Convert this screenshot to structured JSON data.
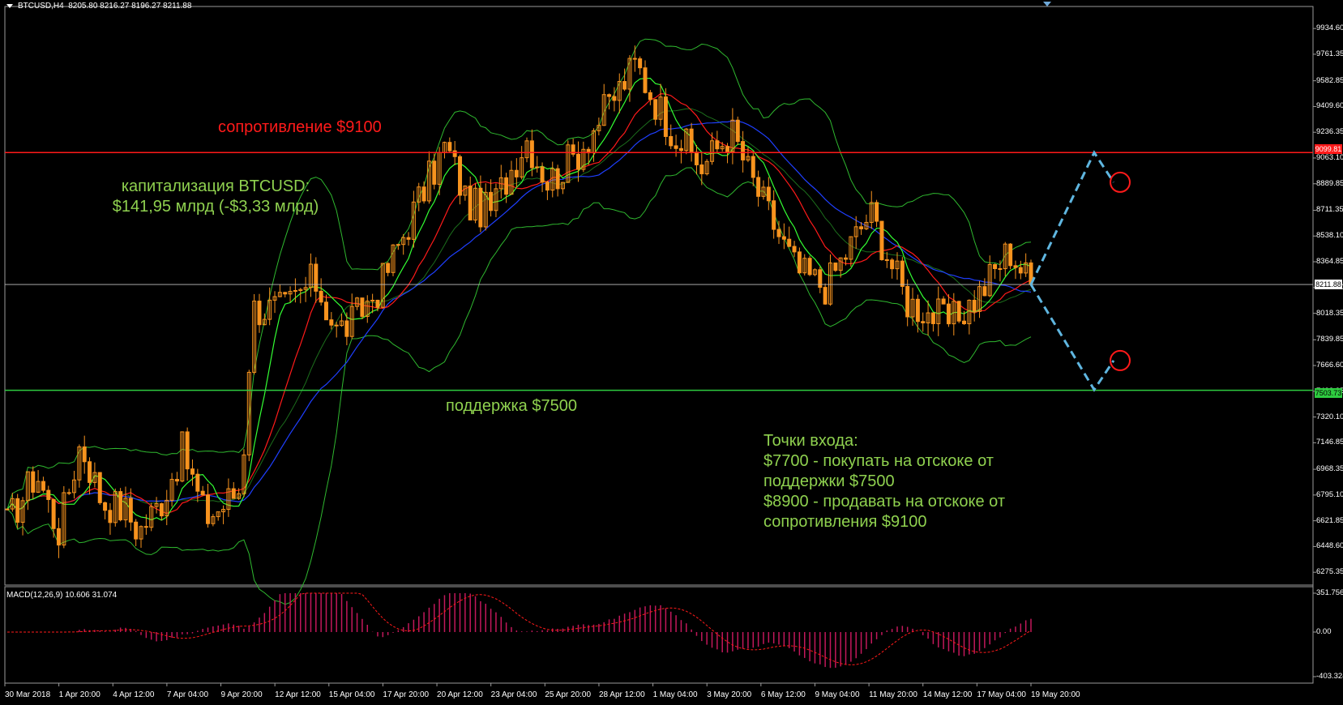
{
  "header": {
    "symbol": "BTCUSD,H4",
    "ohlc": "8205.80 8216.27 8196.27 8211.88"
  },
  "macd_header": "MACD(12,26,9) 10.606 31.074",
  "price_axis": [
    "9934.60",
    "9761.35",
    "9582.85",
    "9409.60",
    "9236.35",
    "9063.10",
    "8889.85",
    "8711.35",
    "8538.10",
    "8364.85",
    "8191.60",
    "8018.35",
    "7839.85",
    "7666.60",
    "7493.35",
    "7320.10",
    "7146.85",
    "6968.35",
    "6795.10",
    "6621.85",
    "6448.60",
    "6275.35"
  ],
  "macd_axis": [
    "351.756",
    "0.00",
    "-403.324"
  ],
  "price_badges": {
    "resistance": "9099.81",
    "support": "7503.73",
    "current": "8211.88"
  },
  "date_axis": [
    "30 Mar 2018",
    "1 Apr 20:00",
    "4 Apr 12:00",
    "7 Apr 04:00",
    "9 Apr 20:00",
    "12 Apr 12:00",
    "15 Apr 04:00",
    "17 Apr 20:00",
    "20 Apr 12:00",
    "23 Apr 04:00",
    "25 Apr 20:00",
    "28 Apr 12:00",
    "1 May 04:00",
    "3 May 20:00",
    "6 May 12:00",
    "9 May 04:00",
    "11 May 20:00",
    "14 May 12:00",
    "17 May 04:00",
    "19 May 20:00"
  ],
  "annotations": {
    "resistance": "сопротивление $9100",
    "cap_line1": "капитализация BTCUSD:",
    "cap_line2": "$141,95 млрд (-$3,33 млрд)",
    "support": "поддержка $7500",
    "entry_title": "Точки входа:",
    "entry_line1": "$7700 - покупать на отскоке от",
    "entry_line2": "поддержки $7500",
    "entry_line3": "$8900 - продавать на отскоке от",
    "entry_line4": "сопротивления $9100"
  },
  "colors": {
    "background": "#000000",
    "candle": "#f7931e",
    "resistance": "#ff1a1a",
    "support": "#2ecc40",
    "bollinger": "#2fb82f",
    "ma_blue": "#1f3fff",
    "ma_red": "#ff1a1a",
    "ma_green": "#33ff33",
    "macd_hist": "#c2185b",
    "macd_signal": "#ff1a1a",
    "projection": "#5fb6e0"
  },
  "levels": {
    "resistance": 9100,
    "support": 7500,
    "current": 8211.88
  },
  "projection": {
    "start_price": 8211.88,
    "peak_price": 9099.81,
    "peak_target": 8900,
    "trough_price": 7503.73,
    "trough_target": 7700
  },
  "price_path": [
    [
      6600,
      0
    ],
    [
      6950,
      0.04
    ],
    [
      6550,
      0.07
    ],
    [
      7150,
      0.1
    ],
    [
      6750,
      0.13
    ],
    [
      6700,
      0.16
    ],
    [
      6550,
      0.18
    ],
    [
      6750,
      0.21
    ],
    [
      7100,
      0.24
    ],
    [
      6650,
      0.27
    ],
    [
      6700,
      0.29
    ],
    [
      6850,
      0.32
    ],
    [
      8050,
      0.335
    ],
    [
      8050,
      0.38
    ],
    [
      8250,
      0.42
    ],
    [
      7900,
      0.45
    ],
    [
      7950,
      0.47
    ],
    [
      8200,
      0.51
    ],
    [
      8750,
      0.56
    ],
    [
      9150,
      0.6
    ],
    [
      8750,
      0.63
    ],
    [
      8700,
      0.66
    ],
    [
      9200,
      0.71
    ],
    [
      8900,
      0.74
    ],
    [
      9100,
      0.78
    ],
    [
      9700,
      0.86
    ],
    [
      9500,
      0.88
    ],
    [
      9250,
      0.91
    ],
    [
      9000,
      0.95
    ],
    [
      9250,
      0.99
    ],
    [
      8900,
      1.02
    ],
    [
      8300,
      1.08
    ],
    [
      8200,
      1.12
    ],
    [
      8700,
      1.18
    ],
    [
      8100,
      1.23
    ],
    [
      7950,
      1.29
    ],
    [
      8150,
      1.33
    ],
    [
      8450,
      1.37
    ],
    [
      8212,
      1.4
    ]
  ]
}
